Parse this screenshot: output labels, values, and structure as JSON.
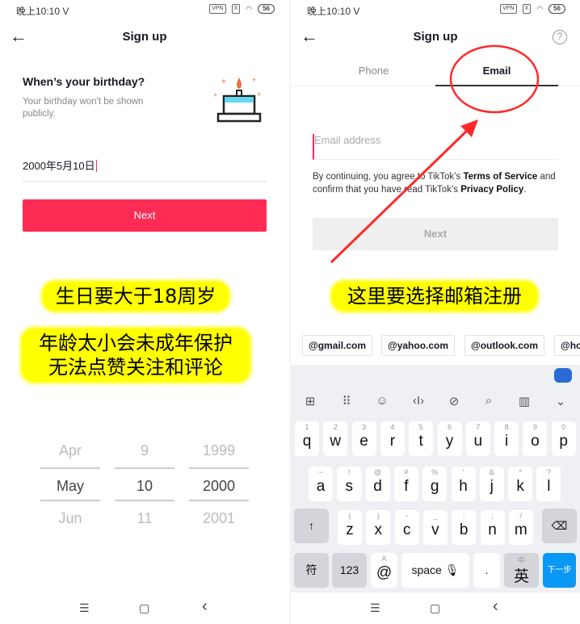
{
  "status_bar": {
    "time": "晚上10:10",
    "carrier_icon": "V",
    "vpn": "VPN",
    "sim": "X",
    "wifi_icon": "wifi-icon",
    "battery": "56"
  },
  "left": {
    "header": {
      "title": "Sign up",
      "back_icon": "arrow-left-icon"
    },
    "heading": "When’s your birthday?",
    "subtext": "Your birthday won't be shown publicly.",
    "cake_icon": "birthday-cake-icon",
    "birthday_value": "2000年5月10日",
    "next_label": "Next",
    "accent": "#fe2c55",
    "annotation1": "生日要大于18周岁",
    "annotation2_line1": "年龄太小会未成年保护",
    "annotation2_line2": "无法点赞关注和评论",
    "picker": {
      "month": [
        "Apr",
        "May",
        "Jun"
      ],
      "day": [
        "9",
        "10",
        "11"
      ],
      "year": [
        "1999",
        "2000",
        "2001"
      ]
    }
  },
  "right": {
    "header": {
      "title": "Sign up",
      "help_icon": "question-circle-icon"
    },
    "tabs": [
      {
        "label": "Phone",
        "active": false
      },
      {
        "label": "Email",
        "active": true
      }
    ],
    "email_placeholder": "Email address",
    "terms": {
      "pre": "By continuing, you agree to TikTok’s ",
      "tos": "Terms of Service",
      "mid": " and confirm that you have read TikTok’s ",
      "privacy": "Privacy Policy",
      "end": "."
    },
    "next_label": "Next",
    "annotation": "这里要选择邮箱注册",
    "annotation_color": "#ff2a2a",
    "email_suggestions": [
      "@gmail.com",
      "@yahoo.com",
      "@outlook.com",
      "@ho"
    ],
    "keyboard": {
      "toolbar_icons": [
        "grid-icon",
        "keyboard-icon",
        "emoji-icon",
        "cursor-icon",
        "link-icon",
        "search-icon",
        "book-icon",
        "chevron-down-icon"
      ],
      "row1": [
        [
          "q",
          "1"
        ],
        [
          "w",
          "2"
        ],
        [
          "e",
          "3"
        ],
        [
          "r",
          "4"
        ],
        [
          "t",
          "5"
        ],
        [
          "y",
          "6"
        ],
        [
          "u",
          "7"
        ],
        [
          "i",
          "8"
        ],
        [
          "o",
          "9"
        ],
        [
          "p",
          "0"
        ]
      ],
      "row2": [
        [
          "a",
          "~"
        ],
        [
          "s",
          "!"
        ],
        [
          "d",
          "@"
        ],
        [
          "f",
          "#"
        ],
        [
          "g",
          "%"
        ],
        [
          "h",
          "'"
        ],
        [
          "j",
          "&"
        ],
        [
          "k",
          "*"
        ],
        [
          "l",
          "?"
        ]
      ],
      "row3": [
        [
          "z",
          "("
        ],
        [
          "x",
          ")"
        ],
        [
          "c",
          "-"
        ],
        [
          "v",
          "_"
        ],
        [
          "b",
          ":"
        ],
        [
          "n",
          ";"
        ],
        [
          "m",
          "/"
        ]
      ],
      "symbols": "符",
      "numbers": "123",
      "alt_top": "A",
      "alt_bottom": "@",
      "space": "space",
      "period": ".",
      "lang_top": "中",
      "lang_bottom": "英",
      "enter": "下一步",
      "enter_color": "#0a98f5"
    }
  },
  "nav_bar": {
    "menu": "☰",
    "home": "▢",
    "back": "‹"
  }
}
